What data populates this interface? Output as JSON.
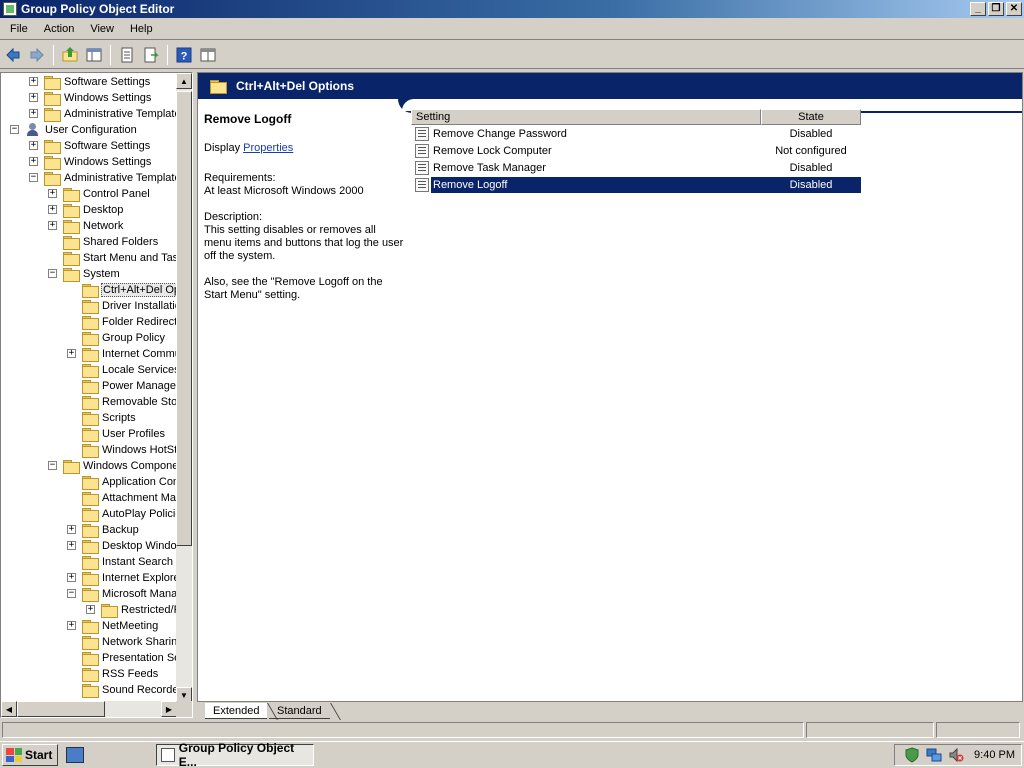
{
  "window": {
    "title": "Group Policy Object Editor"
  },
  "menu": [
    "File",
    "Action",
    "View",
    "Help"
  ],
  "tree": [
    {
      "label": "Software Settings",
      "level": 1,
      "exp": "+",
      "icon": "folder"
    },
    {
      "label": "Windows Settings",
      "level": 1,
      "exp": "+",
      "icon": "folder"
    },
    {
      "label": "Administrative Templates",
      "level": 1,
      "exp": "+",
      "icon": "folder"
    },
    {
      "label": "User Configuration",
      "level": 0,
      "exp": "-",
      "icon": "user"
    },
    {
      "label": "Software Settings",
      "level": 1,
      "exp": "+",
      "icon": "folder"
    },
    {
      "label": "Windows Settings",
      "level": 1,
      "exp": "+",
      "icon": "folder"
    },
    {
      "label": "Administrative Templates",
      "level": 1,
      "exp": "-",
      "icon": "folder"
    },
    {
      "label": "Control Panel",
      "level": 2,
      "exp": "+",
      "icon": "folder"
    },
    {
      "label": "Desktop",
      "level": 2,
      "exp": "+",
      "icon": "folder"
    },
    {
      "label": "Network",
      "level": 2,
      "exp": "+",
      "icon": "folder"
    },
    {
      "label": "Shared Folders",
      "level": 2,
      "exp": "",
      "icon": "folder"
    },
    {
      "label": "Start Menu and Taskbar",
      "level": 2,
      "exp": "",
      "icon": "folder"
    },
    {
      "label": "System",
      "level": 2,
      "exp": "-",
      "icon": "folder"
    },
    {
      "label": "Ctrl+Alt+Del Options",
      "level": 3,
      "exp": "",
      "icon": "folder",
      "selected": true
    },
    {
      "label": "Driver Installation",
      "level": 3,
      "exp": "",
      "icon": "folder"
    },
    {
      "label": "Folder Redirection",
      "level": 3,
      "exp": "",
      "icon": "folder"
    },
    {
      "label": "Group Policy",
      "level": 3,
      "exp": "",
      "icon": "folder"
    },
    {
      "label": "Internet Communication Management",
      "level": 3,
      "exp": "+",
      "icon": "folder"
    },
    {
      "label": "Locale Services",
      "level": 3,
      "exp": "",
      "icon": "folder"
    },
    {
      "label": "Power Management",
      "level": 3,
      "exp": "",
      "icon": "folder"
    },
    {
      "label": "Removable Storage Access",
      "level": 3,
      "exp": "",
      "icon": "folder"
    },
    {
      "label": "Scripts",
      "level": 3,
      "exp": "",
      "icon": "folder"
    },
    {
      "label": "User Profiles",
      "level": 3,
      "exp": "",
      "icon": "folder"
    },
    {
      "label": "Windows HotStart",
      "level": 3,
      "exp": "",
      "icon": "folder"
    },
    {
      "label": "Windows Components",
      "level": 2,
      "exp": "-",
      "icon": "folder"
    },
    {
      "label": "Application Compatibility",
      "level": 3,
      "exp": "",
      "icon": "folder"
    },
    {
      "label": "Attachment Manager",
      "level": 3,
      "exp": "",
      "icon": "folder"
    },
    {
      "label": "AutoPlay Policies",
      "level": 3,
      "exp": "",
      "icon": "folder"
    },
    {
      "label": "Backup",
      "level": 3,
      "exp": "+",
      "icon": "folder"
    },
    {
      "label": "Desktop Window Manager",
      "level": 3,
      "exp": "+",
      "icon": "folder"
    },
    {
      "label": "Instant Search",
      "level": 3,
      "exp": "",
      "icon": "folder"
    },
    {
      "label": "Internet Explorer",
      "level": 3,
      "exp": "+",
      "icon": "folder"
    },
    {
      "label": "Microsoft Management Console",
      "level": 3,
      "exp": "-",
      "icon": "folder"
    },
    {
      "label": "Restricted/Permitted snap-ins",
      "level": 4,
      "exp": "+",
      "icon": "folder"
    },
    {
      "label": "NetMeeting",
      "level": 3,
      "exp": "+",
      "icon": "folder"
    },
    {
      "label": "Network Sharing",
      "level": 3,
      "exp": "",
      "icon": "folder"
    },
    {
      "label": "Presentation Settings",
      "level": 3,
      "exp": "",
      "icon": "folder"
    },
    {
      "label": "RSS Feeds",
      "level": 3,
      "exp": "",
      "icon": "folder"
    },
    {
      "label": "Sound Recorder",
      "level": 3,
      "exp": "",
      "icon": "folder"
    }
  ],
  "header": {
    "title": "Ctrl+Alt+Del Options"
  },
  "description": {
    "title": "Remove Logoff",
    "display_prefix": "Display",
    "display_link": "Properties",
    "requirements_label": "Requirements:",
    "requirements_text": "At least Microsoft Windows 2000",
    "description_label": "Description:",
    "description_text": "This setting disables or removes all menu items and buttons that log the user off the system.",
    "see_also": "Also, see the \"Remove Logoff on the Start Menu\" setting."
  },
  "list": {
    "columns": [
      "Setting",
      "State"
    ],
    "rows": [
      {
        "name": "Remove Change Password",
        "state": "Disabled"
      },
      {
        "name": "Remove Lock Computer",
        "state": "Not configured"
      },
      {
        "name": "Remove Task Manager",
        "state": "Disabled"
      },
      {
        "name": "Remove Logoff",
        "state": "Disabled",
        "selected": true
      }
    ]
  },
  "tabs": [
    "Extended",
    "Standard"
  ],
  "taskbar": {
    "start": "Start",
    "task_label": "Group Policy Object E...",
    "clock": "9:40 PM"
  }
}
